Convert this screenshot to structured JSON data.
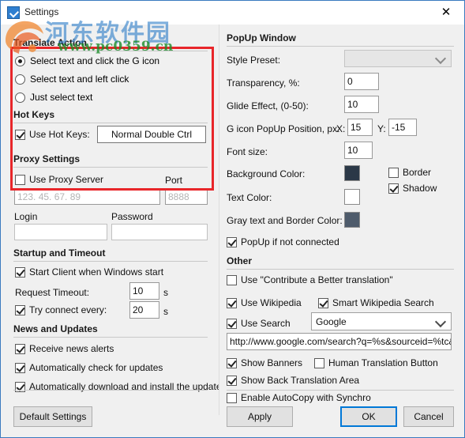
{
  "window": {
    "title": "Settings",
    "close_label": "✕",
    "app_icon": "settings-app-icon"
  },
  "watermark": {
    "site_cn": "河东软件园",
    "site_url": "www.pc0359.cn"
  },
  "left": {
    "translate_action": {
      "title": "Translate Action",
      "options": [
        {
          "label": "Select text and click the G icon",
          "selected": true
        },
        {
          "label": "Select text and left click",
          "selected": false
        },
        {
          "label": "Just select text",
          "selected": false
        }
      ]
    },
    "hot_keys": {
      "title": "Hot Keys",
      "use_hot_keys": {
        "label": "Use Hot Keys:",
        "checked": true
      },
      "hotkey_value": "Normal Double Ctrl"
    },
    "proxy_settings": {
      "title": "Proxy Settings",
      "use_proxy": {
        "label": "Use Proxy Server",
        "checked": false
      },
      "port_label": "Port",
      "server_placeholder": "123. 45. 67. 89",
      "port_placeholder": "8888",
      "login_label": "Login",
      "password_label": "Password",
      "login_value": "",
      "password_value": ""
    },
    "startup_timeout": {
      "title": "Startup and Timeout",
      "start_client": {
        "label": "Start Client when Windows start",
        "checked": true
      },
      "request_timeout_label": "Request Timeout:",
      "request_timeout_value": "10",
      "request_timeout_unit": "s",
      "try_connect": {
        "label": "Try connect every:",
        "checked": true
      },
      "try_connect_value": "20",
      "try_connect_unit": "s"
    },
    "news_updates": {
      "title": "News and Updates",
      "items": [
        {
          "label": "Receive news alerts",
          "checked": true
        },
        {
          "label": "Automatically check for updates",
          "checked": true
        },
        {
          "label": "Automatically download and install the update",
          "checked": true
        }
      ]
    },
    "default_settings_button": "Default Settings"
  },
  "right": {
    "popup_window": {
      "title": "PopUp Window",
      "style_preset_label": "Style Preset:",
      "style_preset_value": "",
      "transparency_label": "Transparency, %:",
      "transparency_value": "0",
      "glide_label": "Glide Effect, (0-50):",
      "glide_value": "10",
      "gicon_pos_label": "G icon PopUp Position, px:",
      "gicon_x_label": "X:",
      "gicon_x_value": "15",
      "gicon_y_label": "Y:",
      "gicon_y_value": "-15",
      "font_size_label": "Font size:",
      "font_size_value": "10",
      "background_color_label": "Background Color:",
      "background_color_value": "#2b3847",
      "text_color_label": "Text Color:",
      "text_color_value": "#ffffff",
      "gray_color_label": "Gray text and Border Color:",
      "gray_color_value": "#4e5b6b",
      "border": {
        "label": "Border",
        "checked": false
      },
      "shadow": {
        "label": "Shadow",
        "checked": true
      },
      "popup_if_not_connected": {
        "label": "PopUp if not connected",
        "checked": true
      }
    },
    "other": {
      "title": "Other",
      "contribute": {
        "label": "Use \"Contribute a Better translation\"",
        "checked": false
      },
      "use_wikipedia": {
        "label": "Use Wikipedia",
        "checked": true
      },
      "smart_wikipedia": {
        "label": "Smart Wikipedia Search",
        "checked": true
      },
      "use_search": {
        "label": "Use Search",
        "checked": true
      },
      "search_engine": "Google",
      "search_url": "http://www.google.com/search?q=%s&sourceid=%tc&ie",
      "show_banners": {
        "label": "Show Banners",
        "checked": true
      },
      "human_translation": {
        "label": "Human Translation Button",
        "checked": false
      },
      "show_back_translation": {
        "label": "Show Back Translation Area",
        "checked": true
      },
      "enable_autocopy": {
        "label": "Enable AutoCopy with Synchro",
        "checked": false
      }
    }
  },
  "footer": {
    "apply": "Apply",
    "ok": "OK",
    "cancel": "Cancel"
  }
}
